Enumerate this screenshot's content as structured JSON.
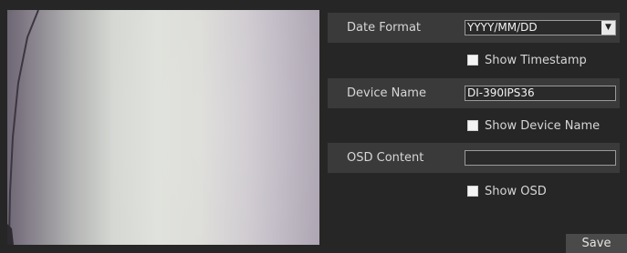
{
  "date_format": {
    "label": "Date Format",
    "value": "YYYY/MM/DD"
  },
  "show_timestamp": {
    "label": "Show Timestamp",
    "checked": false
  },
  "device_name": {
    "label": "Device Name",
    "value": "DI-390IPS36"
  },
  "show_device_name": {
    "label": "Show Device Name",
    "checked": false
  },
  "osd_content": {
    "label": "OSD Content",
    "value": ""
  },
  "show_osd": {
    "label": "Show OSD",
    "checked": false
  },
  "save_label": "Save"
}
